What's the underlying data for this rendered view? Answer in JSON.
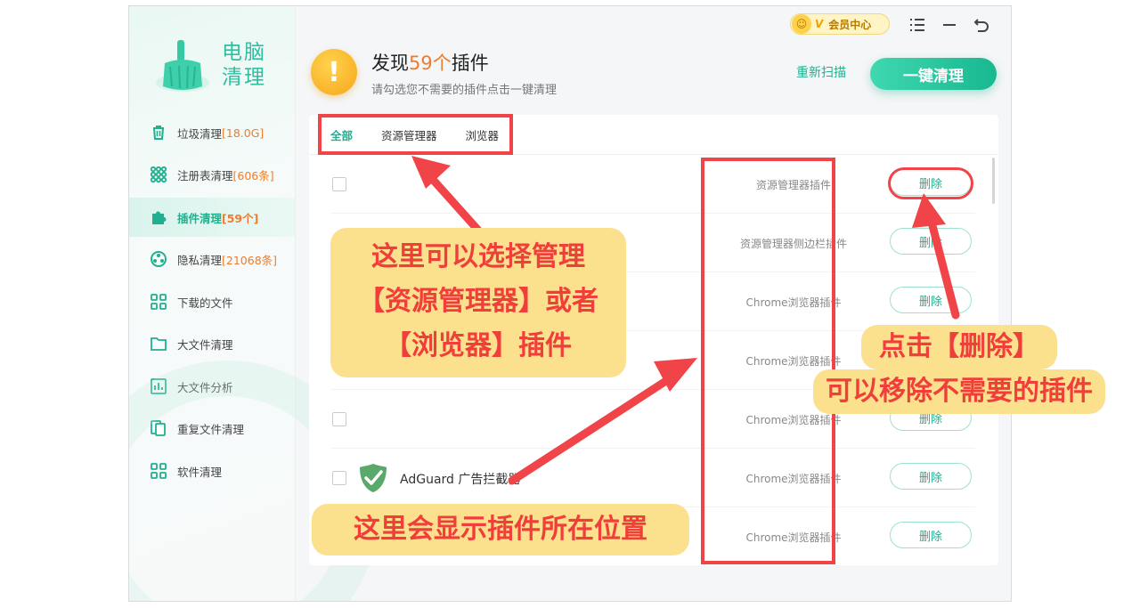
{
  "app": {
    "logo_text_line1": "电脑",
    "logo_text_line2": "清理"
  },
  "topbar": {
    "vip_v": "V",
    "vip_label": "会员中心",
    "menu_icon": "list-icon",
    "minimize_icon": "minimize-icon",
    "back_icon": "back-icon"
  },
  "sidebar": {
    "items": [
      {
        "label": "垃圾清理",
        "count": "[18.0G]",
        "icon": "trash-icon"
      },
      {
        "label": "注册表清理",
        "count": "[606条]",
        "icon": "registry-icon"
      },
      {
        "label": "插件清理",
        "count": "[59个]",
        "icon": "plugin-icon",
        "active": true
      },
      {
        "label": "隐私清理",
        "count": "[21068条]",
        "icon": "privacy-icon"
      },
      {
        "label": "下载的文件",
        "count": "",
        "icon": "download-icon"
      },
      {
        "label": "大文件清理",
        "count": "",
        "icon": "folder-icon"
      },
      {
        "label": "大文件分析",
        "count": "",
        "icon": "chart-icon"
      },
      {
        "label": "重复文件清理",
        "count": "",
        "icon": "duplicate-icon"
      },
      {
        "label": "软件清理",
        "count": "",
        "icon": "apps-icon"
      }
    ]
  },
  "header": {
    "title_prefix": "发现",
    "title_count": "59个",
    "title_suffix": "插件",
    "subtitle": "请勾选您不需要的插件点击一键清理",
    "rescan": "重新扫描",
    "clean_button": "一键清理"
  },
  "tabs": [
    "全部",
    "资源管理器",
    "浏览器"
  ],
  "rows": [
    {
      "name": "",
      "location": "资源管理器插件",
      "delete": "删除"
    },
    {
      "name": "",
      "location": "资源管理器侧边栏插件",
      "delete": "删除"
    },
    {
      "name": "",
      "location": "Chrome浏览器插件",
      "delete": "删除"
    },
    {
      "name": "",
      "location": "Chrome浏览器插件",
      "delete": "删除"
    },
    {
      "name": "",
      "location": "Chrome浏览器插件",
      "delete": "删除"
    },
    {
      "name": "AdGuard 广告拦截器",
      "location": "Chrome浏览器插件",
      "delete": "删除"
    },
    {
      "name": "",
      "location": "Chrome浏览器插件",
      "delete": "删除"
    }
  ],
  "annotations": {
    "tabs_note": [
      "这里可以选择管理",
      "【资源管理器】或者",
      "【浏览器】插件"
    ],
    "delete_note": [
      "点击【删除】",
      "可以移除不需要的插件"
    ],
    "location_note": "这里会显示插件所在位置"
  },
  "colors": {
    "accent": "#1fb08f",
    "count": "#f07b2b",
    "annotation_red": "#f04448",
    "callout_bg": "#fbe08e"
  }
}
